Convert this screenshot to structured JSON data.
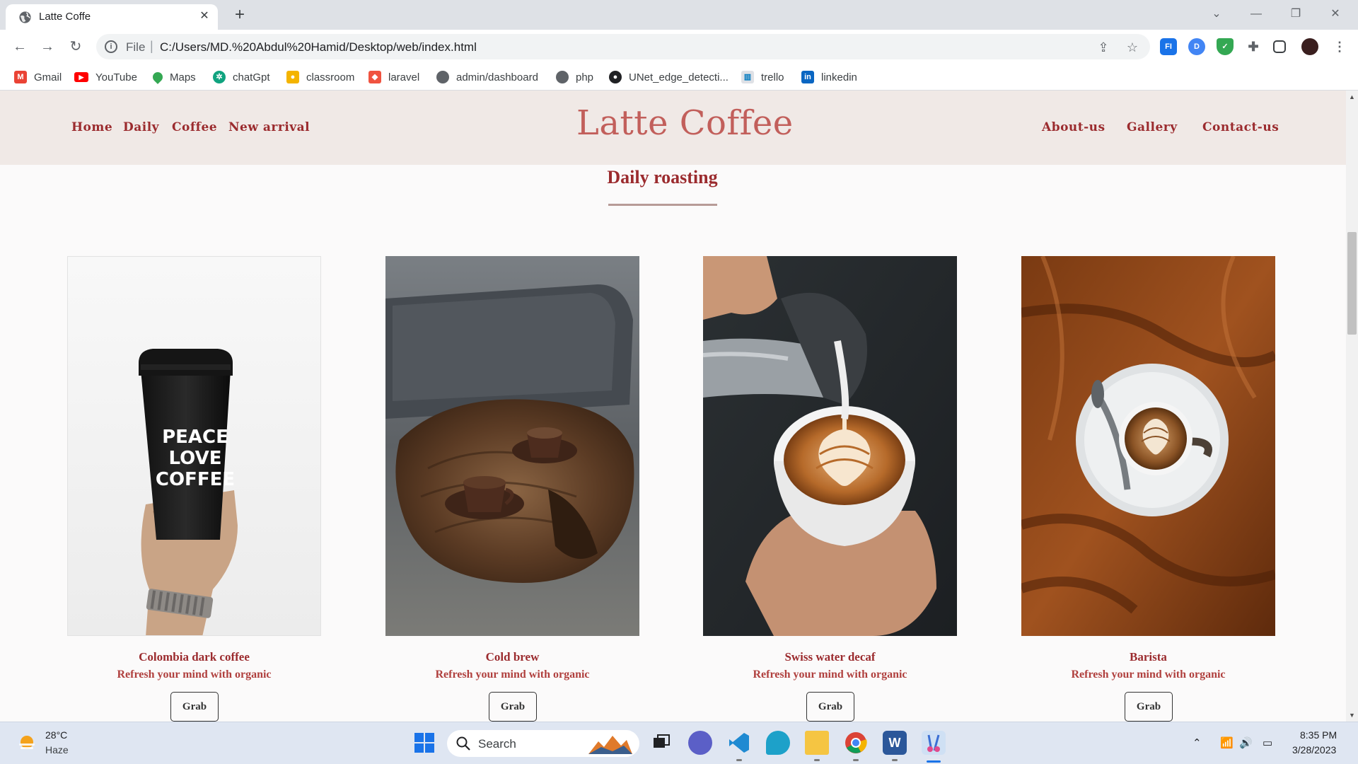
{
  "browser": {
    "tab_title": "Latte Coffe",
    "url_scheme": "File",
    "url": "C:/Users/MD.%20Abdul%20Hamid/Desktop/web/index.html",
    "bookmarks": [
      {
        "label": "Gmail",
        "icon": "gmail-icon",
        "color": "#ea4335"
      },
      {
        "label": "YouTube",
        "icon": "youtube-icon",
        "color": "#ff0000"
      },
      {
        "label": "Maps",
        "icon": "maps-icon",
        "color": "#34a853"
      },
      {
        "label": "chatGpt",
        "icon": "chatgpt-icon",
        "color": "#10a37f"
      },
      {
        "label": "classroom",
        "icon": "classroom-icon",
        "color": "#f4b400"
      },
      {
        "label": "laravel",
        "icon": "laravel-icon",
        "color": "#f05340"
      },
      {
        "label": "admin/dashboard",
        "icon": "globe-icon",
        "color": "#5f6368"
      },
      {
        "label": "php",
        "icon": "globe-icon",
        "color": "#5f6368"
      },
      {
        "label": "UNet_edge_detecti...",
        "icon": "github-icon",
        "color": "#202124"
      },
      {
        "label": "trello",
        "icon": "trello-icon",
        "color": "#0079bf"
      },
      {
        "label": "linkedin",
        "icon": "linkedin-icon",
        "color": "#0a66c2"
      }
    ]
  },
  "site": {
    "brand": "Latte Coffee",
    "nav_left": [
      "Home",
      "Daily",
      "Coffee",
      "New arrival"
    ],
    "nav_right": [
      "About-us",
      "Gallery",
      "Contact-us"
    ],
    "section_title": "Daily roasting",
    "accent_color": "#9b2b2e",
    "header_bg": "#f0e9e6",
    "products": [
      {
        "name": "Colombia dark coffee",
        "desc": "Refresh your mind with organic",
        "button": "Grab"
      },
      {
        "name": "Cold brew",
        "desc": "Refresh your mind with organic",
        "button": "Grab"
      },
      {
        "name": "Swiss water decaf",
        "desc": "Refresh your mind with organic",
        "button": "Grab"
      },
      {
        "name": "Barista",
        "desc": "Refresh your mind with organic",
        "button": "Grab"
      }
    ],
    "cup_print": [
      "PEACE",
      "LOVE",
      "COFFEE"
    ]
  },
  "taskbar": {
    "weather_temp": "28°C",
    "weather_cond": "Haze",
    "search_label": "Search",
    "clock_time": "8:35 PM",
    "clock_date": "3/28/2023"
  }
}
